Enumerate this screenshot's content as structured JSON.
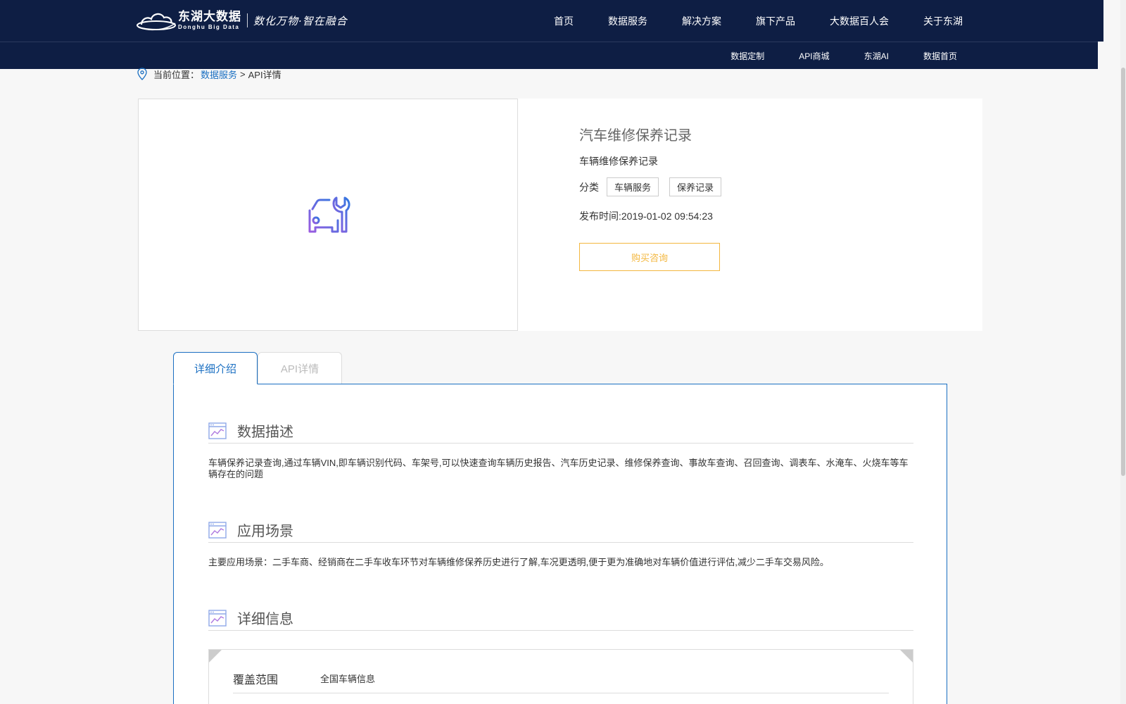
{
  "brand": {
    "name_cn": "东湖大数据",
    "name_en": "Donghu Big Data",
    "slogan": "数化万物·智在融合"
  },
  "main_nav": [
    "首页",
    "数据服务",
    "解决方案",
    "旗下产品",
    "大数据百人会",
    "关于东湖"
  ],
  "sub_nav": [
    "数据定制",
    "API商城",
    "东湖AI",
    "数据首页"
  ],
  "breadcrumb": {
    "prefix": "当前位置：",
    "link": "数据服务",
    "separator": ">",
    "current": "API详情"
  },
  "product": {
    "title": "汽车维修保养记录",
    "subtitle": "车辆维修保养记录",
    "category_label": "分类",
    "tags": [
      "车辆服务",
      "保养记录"
    ],
    "publish_time": "发布时间:2019-01-02 09:54:23",
    "consult_button": "购买咨询",
    "icon": "car-wrench-icon"
  },
  "tabs": [
    {
      "label": "详细介绍",
      "active": true
    },
    {
      "label": "API详情",
      "active": false
    }
  ],
  "sections": {
    "description": {
      "title": "数据描述",
      "body": "车辆保养记录查询,通过车辆VIN,即车辆识别代码、车架号,可以快速查询车辆历史报告、汽车历史记录、维修保养查询、事故车查询、召回查询、调表车、水淹车、火烧车等车辆存在的问题"
    },
    "scenario": {
      "title": "应用场景",
      "body": "主要应用场景：二手车商、经销商在二手车收车环节对车辆维修保养历史进行了解,车况更透明,便于更为准确地对车辆价值进行评估,减少二手车交易风险。"
    },
    "details": {
      "title": "详细信息",
      "rows": [
        {
          "key": "覆盖范围",
          "value": "全国车辆信息"
        }
      ]
    }
  },
  "colors": {
    "header_bg": "#0e1e44",
    "link": "#1a6fc2",
    "button_accent": "#f3b73f"
  }
}
